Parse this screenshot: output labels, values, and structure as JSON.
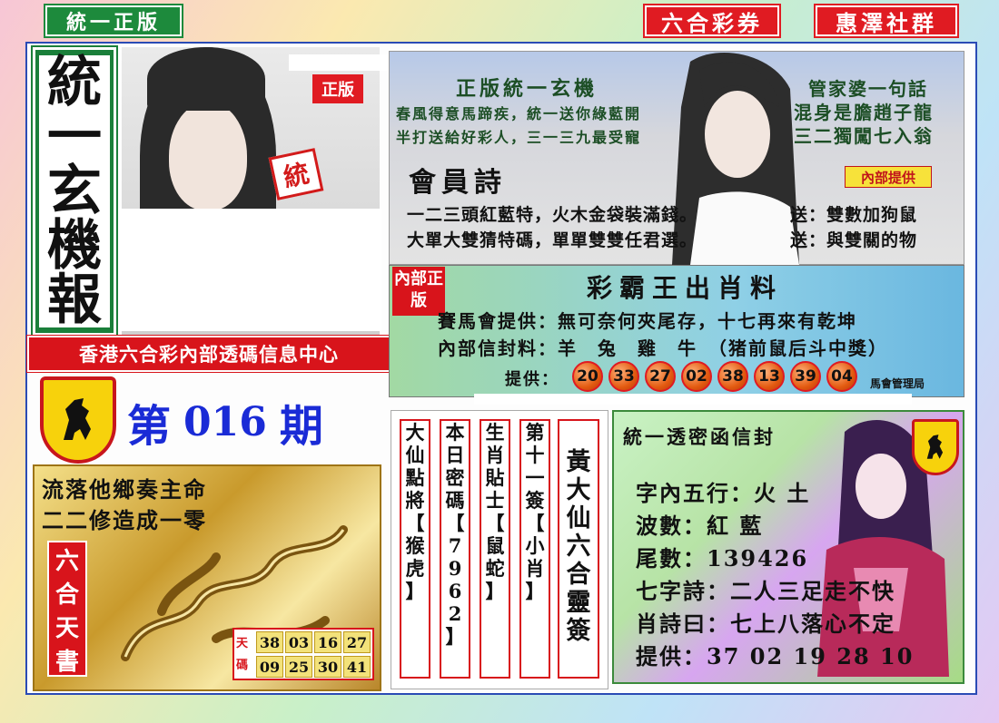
{
  "top_labels": {
    "left": "統一正版",
    "center": "六合彩券",
    "right": "惠澤社群"
  },
  "vertical_title": [
    "統",
    "一",
    "玄",
    "機",
    "報"
  ],
  "stamp_left": "正版",
  "tong_label": "統",
  "banner": "香港六合彩內部透碼信息中心",
  "issue": {
    "prefix": "第",
    "number": "016",
    "suffix": "期"
  },
  "gold_panel": {
    "line1": "流落他鄉奏主命",
    "line2": "二二修造成一零",
    "tianshu": [
      "六",
      "合",
      "天",
      "書"
    ],
    "label": "天碼",
    "numbers_row1": [
      "38",
      "03",
      "16",
      "27"
    ],
    "numbers_row2": [
      "09",
      "25",
      "30",
      "41"
    ]
  },
  "top_panel": {
    "title": "正版統一玄機",
    "line1": "春風得意馬蹄疾，統一送你綠藍開",
    "line2": "半打送給好彩人，三一三九最受寵",
    "right_title": "管家婆一句話",
    "right_line1": "混身是膽趙子龍",
    "right_line2": "三二獨闖七入翁",
    "huiyuan": "會員詩",
    "neibu": "內部提供",
    "poem1": "一二三頭紅藍特，火木金袋裝滿錢。",
    "poem1_right": "送：雙數加狗鼠",
    "poem2": "大單大雙猜特碼，單單雙雙任君選。",
    "poem2_right": "送：與雙關的物"
  },
  "cai_panel": {
    "badge": "內部正版",
    "title": "彩霸王出肖料",
    "line1": "賽馬會提供：無可奈何夾尾存，十七再來有乾坤",
    "line2": "內部信封料：羊　兔　雞　牛　（猪前鼠后斗中獎）",
    "provide": "提供：",
    "balls": [
      "20",
      "33",
      "27",
      "02",
      "38",
      "13",
      "39",
      "04"
    ],
    "footer": "馬會管理局"
  },
  "columns": [
    {
      "chars": [
        "大",
        "仙",
        "點",
        "將",
        "【",
        "猴",
        "",
        "虎",
        "】"
      ]
    },
    {
      "chars": [
        "本",
        "日",
        "密",
        "碼",
        "【",
        "7",
        "9",
        "6",
        "2",
        "】"
      ]
    },
    {
      "chars": [
        "生",
        "肖",
        "貼",
        "士",
        "【",
        "鼠",
        "",
        "蛇",
        "】"
      ]
    },
    {
      "chars": [
        "第",
        "十",
        "一",
        "簽",
        "【",
        "小",
        "",
        "肖",
        "】"
      ]
    }
  ],
  "big_column": [
    "黃",
    "大",
    "仙",
    "六",
    "合",
    "靈",
    "簽"
  ],
  "right_panel": {
    "title": "統一透密函信封",
    "wuxing_label": "字內五行：",
    "wuxing": "火 土",
    "bose_label": "波數：",
    "bose": "紅 藍",
    "weishu_label": "尾數：",
    "weishu": "139426",
    "qizi_label": "七字詩：",
    "qizi": "二人三足走不快",
    "xiaoshi_label": "肖詩曰：",
    "xiaoshi": "七上八落心不定",
    "provide_label": "提供：",
    "provide": "37 02 19 28 10"
  },
  "colors": {
    "red": "#e01b22",
    "green": "#1d8a3c",
    "blue_issue": "#1a2bd6",
    "ball_orange": "#e35a10",
    "gold": "#c99a2c"
  }
}
